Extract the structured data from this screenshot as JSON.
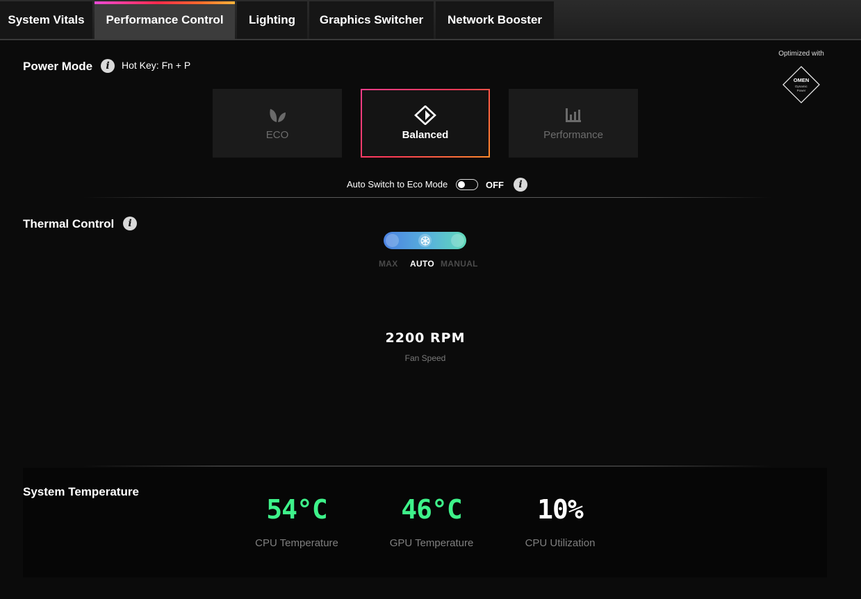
{
  "tabs": [
    {
      "label": "System Vitals"
    },
    {
      "label": "Performance Control"
    },
    {
      "label": "Lighting"
    },
    {
      "label": "Graphics Switcher"
    },
    {
      "label": "Network Booster"
    }
  ],
  "active_tab": "Performance Control",
  "power_mode": {
    "heading": "Power Mode",
    "hotkey": "Hot Key: Fn + P",
    "modes": [
      {
        "label": "ECO",
        "icon": "leaf-icon"
      },
      {
        "label": "Balanced",
        "icon": "balanced-diamond-icon"
      },
      {
        "label": "Performance",
        "icon": "bar-chart-icon"
      }
    ],
    "selected": "Balanced",
    "auto_switch_label": "Auto Switch to Eco Mode",
    "auto_switch_state": "OFF"
  },
  "badge": {
    "label": "Optimized with",
    "logo_text": "OMEN",
    "logo_subtext_1": "Dynamic",
    "logo_subtext_2": "Power"
  },
  "thermal": {
    "heading": "Thermal Control",
    "options": [
      "MAX",
      "AUTO",
      "MANUAL"
    ],
    "selected": "AUTO",
    "fan_speed_value": "2200 RPM",
    "fan_speed_label": "Fan Speed"
  },
  "system_temperature": {
    "heading": "System Temperature",
    "metrics": [
      {
        "value": "54°C",
        "label": "CPU Temperature"
      },
      {
        "value": "46°C",
        "label": "GPU Temperature"
      },
      {
        "value": "10%",
        "label": "CPU Utilization"
      }
    ]
  },
  "colors": {
    "accent_green": "#3ef28a",
    "slider_start": "#4b82e2",
    "slider_end": "#60d9b8"
  }
}
